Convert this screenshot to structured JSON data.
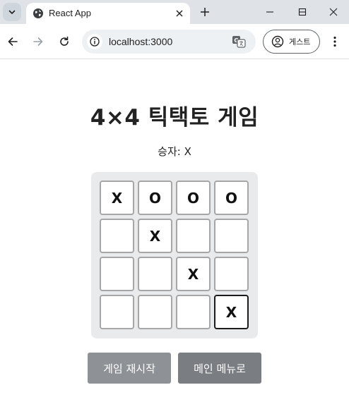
{
  "browser": {
    "tab_title": "React App",
    "url": "localhost:3000",
    "profile_label": "게스트"
  },
  "page": {
    "title": "4×4 틱택토 게임",
    "status_text": "승자: X",
    "board": [
      [
        "X",
        "O",
        "O",
        "O"
      ],
      [
        "",
        "X",
        "",
        ""
      ],
      [
        "",
        "",
        "X",
        ""
      ],
      [
        "",
        "",
        "",
        "X"
      ]
    ],
    "restart_label": "게임 재시작",
    "main_menu_label": "메인 메뉴로"
  }
}
